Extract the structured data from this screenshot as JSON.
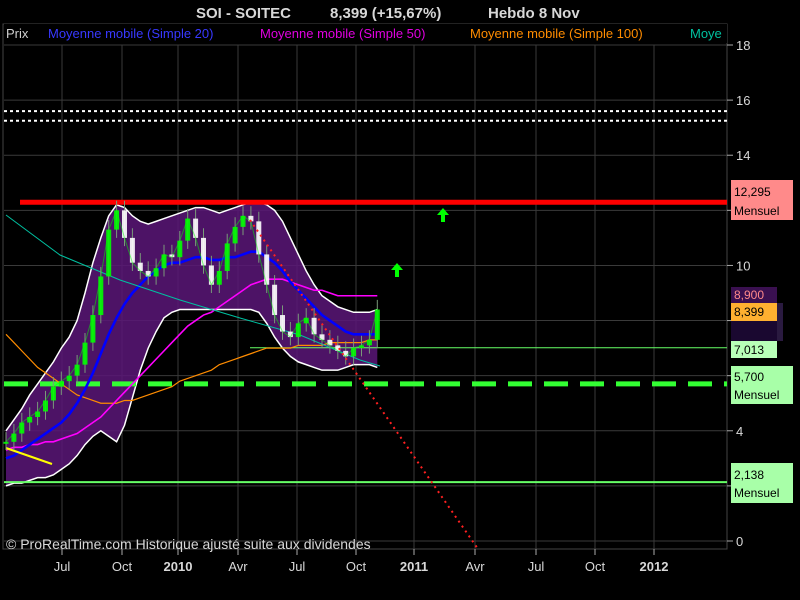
{
  "header": {
    "symbol": "SOI - SOITEC",
    "price_change": "8,399 (+15,67%)",
    "period": "Hebdo  8 Nov"
  },
  "legend": {
    "price": "Prix",
    "ma20": "Moyenne mobile (Simple 20)",
    "ma50": "Moyenne mobile (Simple 50)",
    "ma100": "Moyenne mobile (Simple 100)",
    "ma_cut": "Moye"
  },
  "footer": {
    "copyright": "© ProRealTime.com Historique ajusté suite aux dividendes"
  },
  "badges": {
    "resistance": {
      "value": "12,295",
      "period": "Mensuel"
    },
    "support_mid": {
      "value": "5,700",
      "period": "Mensuel"
    },
    "support_low": {
      "value": "2,138",
      "period": "Mensuel"
    },
    "upper_band": {
      "value": "8,900"
    },
    "last_price": {
      "value": "8,399"
    },
    "horizontal": {
      "value": "7,013"
    }
  },
  "colors": {
    "background": "#000000",
    "price": "#00ff00",
    "ma20": "#0000ff",
    "ma50": "#ff00ff",
    "ma100": "#ff8c00",
    "bollinger_fill": "#5a1678",
    "resistance": "#ff0000",
    "support": "#33ff33",
    "trendline": "#ff2020"
  },
  "chart_data": {
    "type": "line",
    "title": "SOI - SOITEC",
    "y_axis": {
      "ticks": [
        0,
        2,
        4,
        6,
        8,
        10,
        12,
        14,
        16,
        18
      ],
      "range": [
        0,
        18.5
      ],
      "side": "right"
    },
    "x_axis": {
      "ticks": [
        "Jul",
        "Oct",
        "2010",
        "Avr",
        "Jul",
        "Oct",
        "2011",
        "Avr",
        "Jul",
        "Oct",
        "2012"
      ],
      "bold_ticks": [
        "2010",
        "2011",
        "2012"
      ]
    },
    "grid": true,
    "horizontal_lines": [
      {
        "name": "resistance",
        "value": 12.295,
        "style": "solid"
      },
      {
        "name": "support_mid",
        "value": 5.7,
        "style": "dashed"
      },
      {
        "name": "support_low",
        "value": 2.138,
        "style": "solid"
      },
      {
        "name": "level_a",
        "value": 15.6,
        "style": "dotted"
      },
      {
        "name": "level_b",
        "value": 15.25,
        "style": "dotted"
      },
      {
        "name": "level_c",
        "value": 7.013,
        "style": "solid"
      }
    ],
    "arrows": [
      {
        "date": "2011-01",
        "value": 10.1
      },
      {
        "date": "2011-02",
        "value": 12.1
      }
    ],
    "series": [
      {
        "key": "price",
        "values": [
          3.6,
          3.9,
          4.3,
          4.5,
          4.7,
          5.1,
          5.6,
          5.8,
          6.0,
          6.4,
          7.2,
          8.2,
          9.6,
          11.3,
          12.0,
          11.0,
          10.1,
          9.8,
          9.6,
          9.9,
          10.4,
          10.3,
          10.9,
          11.7,
          11.0,
          10.0,
          9.3,
          9.8,
          10.8,
          11.4,
          11.8,
          11.6,
          10.4,
          9.3,
          8.2,
          7.6,
          7.4,
          7.9,
          8.1,
          7.5,
          7.3,
          7.1,
          6.9,
          6.7,
          7.0,
          7.1,
          7.3,
          8.4
        ]
      },
      {
        "key": "ma20",
        "values": [
          3.0,
          3.1,
          3.3,
          3.5,
          3.7,
          3.9,
          4.1,
          4.3,
          4.6,
          5.0,
          5.5,
          6.1,
          6.8,
          7.5,
          8.1,
          8.6,
          9.0,
          9.3,
          9.6,
          9.8,
          10.0,
          10.1,
          10.1,
          10.2,
          10.3,
          10.3,
          10.2,
          10.2,
          10.3,
          10.3,
          10.4,
          10.5,
          10.5,
          10.3,
          10.1,
          9.8,
          9.4,
          9.1,
          8.8,
          8.5,
          8.2,
          8.0,
          7.8,
          7.6,
          7.5,
          7.5,
          7.5,
          7.5
        ]
      },
      {
        "key": "ma50",
        "values": [
          3.3,
          3.4,
          3.4,
          3.5,
          3.5,
          3.6,
          3.6,
          3.7,
          3.8,
          3.9,
          4.1,
          4.3,
          4.5,
          4.8,
          5.1,
          5.4,
          5.7,
          6.0,
          6.3,
          6.6,
          6.9,
          7.2,
          7.5,
          7.8,
          8.0,
          8.2,
          8.3,
          8.5,
          8.7,
          8.9,
          9.1,
          9.3,
          9.4,
          9.5,
          9.5,
          9.5,
          9.4,
          9.3,
          9.2,
          9.1,
          9.1,
          9.0,
          8.9,
          8.9,
          8.9,
          8.9,
          8.9,
          8.9
        ]
      },
      {
        "key": "ma100",
        "values": [
          7.5,
          7.2,
          6.9,
          6.6,
          6.3,
          6.1,
          5.9,
          5.7,
          5.5,
          5.3,
          5.2,
          5.1,
          5.0,
          5.0,
          5.0,
          5.1,
          5.1,
          5.2,
          5.3,
          5.4,
          5.5,
          5.6,
          5.8,
          5.9,
          6.0,
          6.1,
          6.2,
          6.4,
          6.5,
          6.6,
          6.7,
          6.8,
          6.9,
          7.0,
          7.0,
          7.0,
          7.0,
          7.1,
          7.1,
          7.1,
          7.1,
          7.2,
          7.2,
          7.2,
          7.2,
          7.2,
          7.3,
          7.3
        ]
      },
      {
        "key": "bb_upper",
        "values": [
          4.0,
          4.4,
          4.8,
          5.3,
          5.7,
          6.1,
          6.5,
          7.0,
          7.4,
          8.0,
          9.0,
          10.1,
          11.0,
          11.8,
          12.2,
          12.1,
          11.8,
          11.6,
          11.5,
          11.6,
          11.7,
          11.8,
          11.9,
          12.0,
          12.1,
          12.1,
          12.0,
          11.9,
          12.0,
          12.1,
          12.2,
          12.3,
          12.3,
          12.2,
          12.0,
          11.6,
          11.0,
          10.4,
          9.8,
          9.3,
          8.9,
          8.7,
          8.5,
          8.4,
          8.3,
          8.3,
          8.3,
          8.4
        ]
      },
      {
        "key": "bb_lower",
        "values": [
          2.0,
          2.1,
          2.1,
          2.2,
          2.3,
          2.3,
          2.4,
          2.6,
          2.8,
          3.1,
          3.5,
          3.8,
          4.0,
          3.8,
          3.6,
          4.2,
          5.2,
          6.2,
          7.0,
          7.6,
          8.1,
          8.3,
          8.4,
          8.4,
          8.4,
          8.4,
          8.4,
          8.4,
          8.4,
          8.4,
          8.4,
          8.4,
          8.3,
          7.9,
          7.4,
          7.0,
          6.7,
          6.5,
          6.4,
          6.3,
          6.2,
          6.2,
          6.2,
          6.3,
          6.4,
          6.4,
          6.4,
          6.3
        ]
      }
    ]
  }
}
